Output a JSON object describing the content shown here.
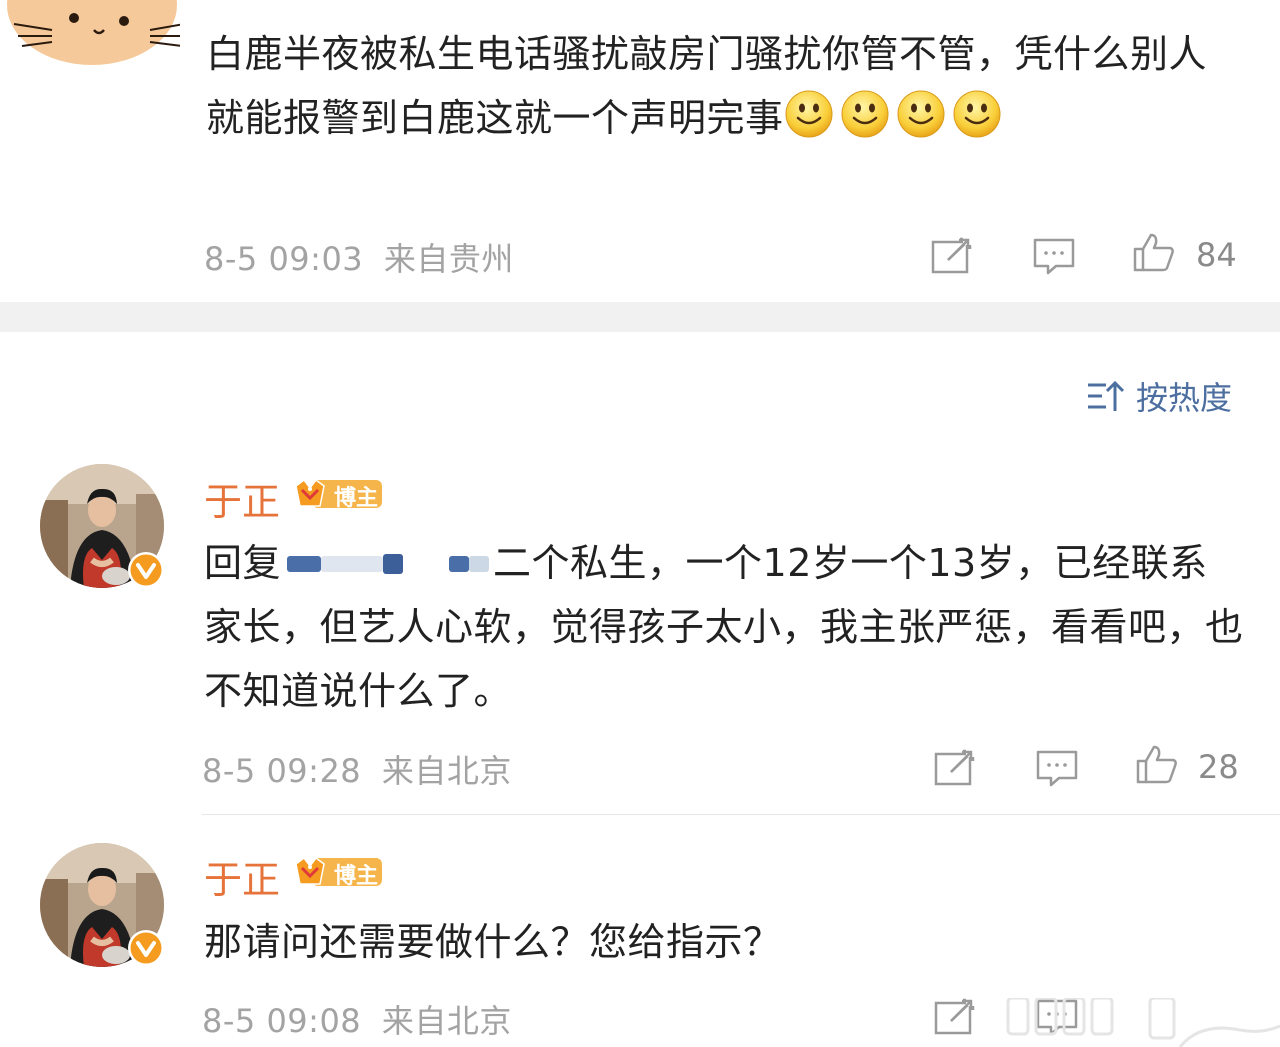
{
  "top_comment": {
    "text": "白鹿半夜被私生电话骚扰敲房门骚扰你管不管，凭什么别人就能报警到白鹿这就一个声明完事",
    "time": "8-5 09:03",
    "location": "来自贵州",
    "likes": "84",
    "emoji_count": 4
  },
  "sort_label": "按热度",
  "replies": [
    {
      "name": "于正",
      "badge": "博主",
      "reply_prefix": "回复",
      "text": "二个私生，一个12岁一个13岁，已经联系家长，但艺人心软，觉得孩子太小，我主张严惩，看看吧，也不知道说什么了。",
      "time": "8-5 09:28",
      "location": "来自北京",
      "likes": "28"
    },
    {
      "name": "于正",
      "badge": "博主",
      "text": "那请问还需要做什么？您给指示？",
      "time": "8-5 09:08",
      "location": "来自北京"
    }
  ],
  "icons": [
    "share-icon",
    "comment-icon",
    "like-icon",
    "sort-icon",
    "verified-v-icon",
    "crown-badge-icon",
    "smile-emoji-icon"
  ],
  "colors": {
    "name": "#e5733a",
    "sort": "#4d6fa0",
    "meta": "#a3a3a3",
    "verified": "#f59b1f"
  }
}
